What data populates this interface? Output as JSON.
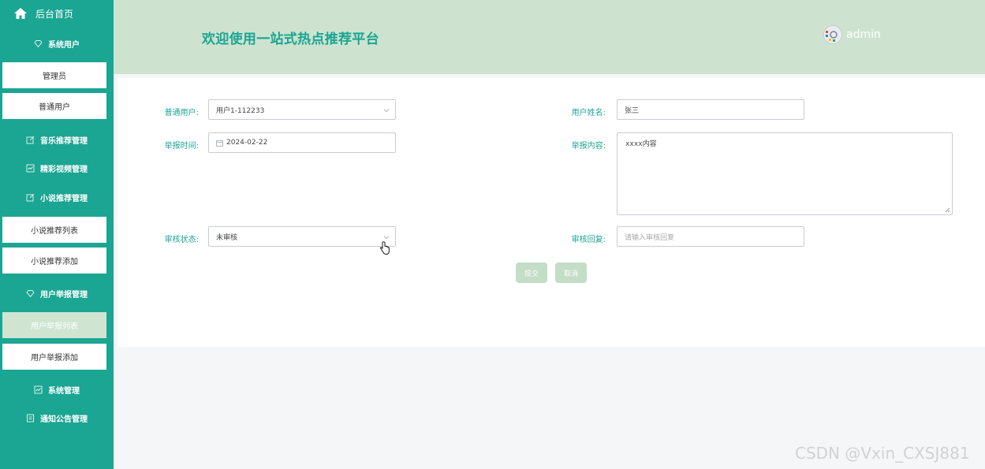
{
  "sidebar": {
    "home_label": "后台首页",
    "groups": {
      "system_users": "系统用户",
      "music": "音乐推荐管理",
      "video": "精彩视频管理",
      "novel": "小说推荐管理",
      "report": "用户举报管理",
      "system": "系统管理",
      "notice": "通知公告管理"
    },
    "items": {
      "admin": "管理员",
      "normal_user": "普通用户",
      "novel_list": "小说推荐列表",
      "novel_add": "小说推荐添加",
      "report_list": "用户举报列表",
      "report_add": "用户举报添加"
    }
  },
  "header": {
    "title": "欢迎使用一站式热点推荐平台",
    "username": "admin"
  },
  "form": {
    "normal_user_label": "普通用户:",
    "normal_user_value": "用户1-112233",
    "user_name_label": "用户姓名:",
    "user_name_value": "张三",
    "report_time_label": "举报时间:",
    "report_time_value": "2024-02-22",
    "report_content_label": "举报内容:",
    "report_content_value": "xxxx内容",
    "review_status_label": "审核状态:",
    "review_status_value": "未审核",
    "review_reply_label": "审核回复:",
    "review_reply_placeholder": "请输入审核回复",
    "submit_label": "提交",
    "cancel_label": "取消"
  },
  "watermark": "CSDN @Vxin_CXSJ881",
  "colors": {
    "primary": "#1ba593",
    "header_bg": "#cde3cf",
    "button_bg": "#c3ddc6"
  }
}
